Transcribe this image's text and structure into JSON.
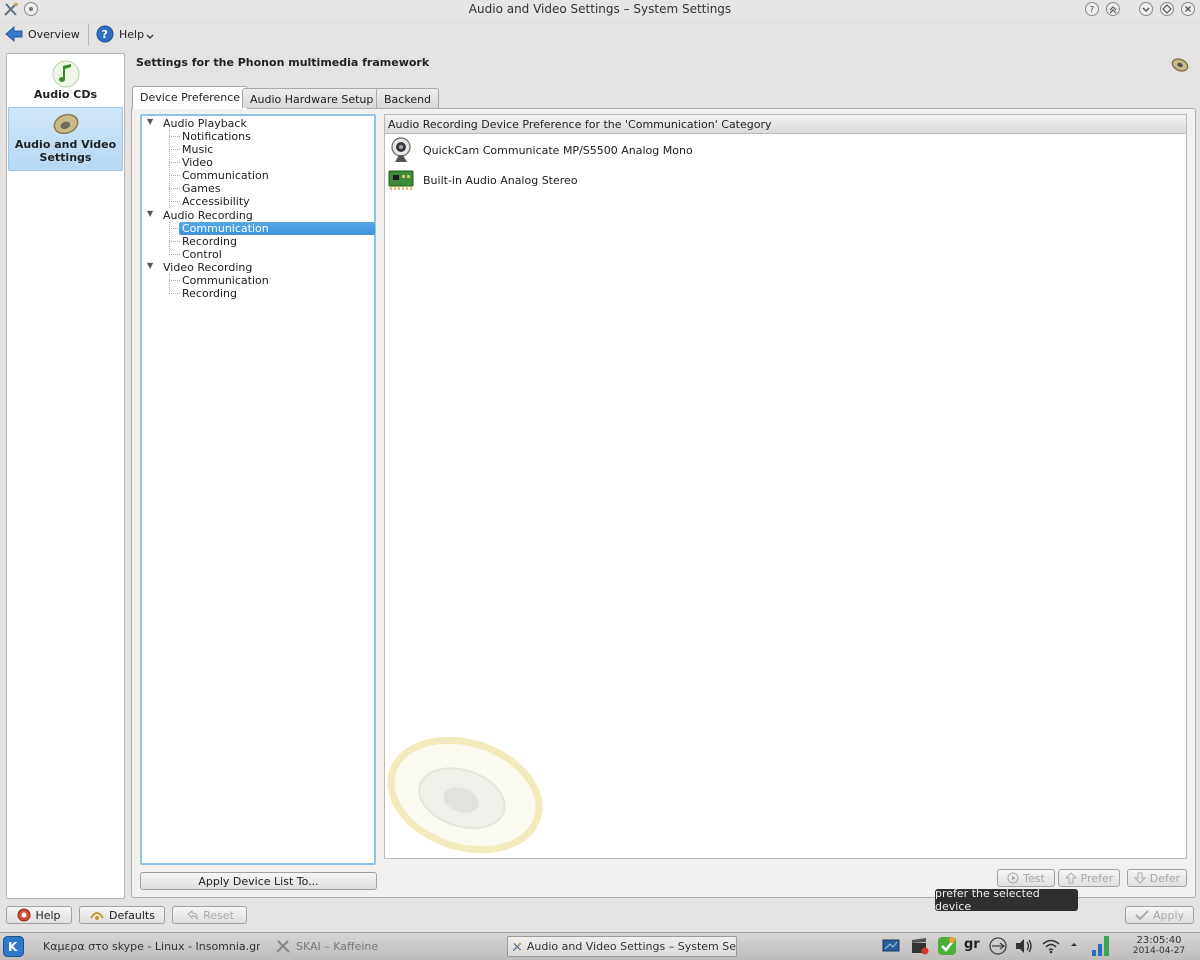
{
  "window": {
    "title": "Audio and Video Settings – System Settings"
  },
  "toolbar": {
    "overview": "Overview",
    "help": "Help"
  },
  "sidebar": {
    "items": [
      {
        "label": "Audio CDs",
        "icon": "music-note-icon"
      },
      {
        "label": "Audio and Video Settings",
        "icon": "speaker-icon",
        "selected": true
      }
    ]
  },
  "page": {
    "heading": "Settings for the Phonon multimedia framework"
  },
  "tabs": [
    {
      "label": "Device Preference",
      "active": true
    },
    {
      "label": "Audio Hardware Setup"
    },
    {
      "label": "Backend"
    }
  ],
  "tree": {
    "audio_playback": {
      "label": "Audio Playback",
      "children": [
        "Notifications",
        "Music",
        "Video",
        "Communication",
        "Games",
        "Accessibility"
      ]
    },
    "audio_recording": {
      "label": "Audio Recording",
      "children": [
        "Communication",
        "Recording",
        "Control"
      ],
      "selected": "Communication"
    },
    "video_recording": {
      "label": "Video Recording",
      "children": [
        "Communication",
        "Recording"
      ]
    }
  },
  "apply_device_list": "Apply Device List To...",
  "device_list": {
    "header": "Audio Recording Device Preference for the 'Communication' Category",
    "devices": [
      "QuickCam Communicate MP/S5500 Analog Mono",
      "Built-in Audio Analog Stereo"
    ]
  },
  "device_buttons": {
    "test": "Test",
    "prefer": "Prefer",
    "defer": "Defer"
  },
  "tooltip": "prefer the selected device",
  "bottom_buttons": {
    "help": "Help",
    "defaults": "Defaults",
    "reset": "Reset",
    "apply": "Apply"
  },
  "taskbar": {
    "tasks": [
      "Καμερα στο skype - Linux - Insomnia.gr",
      "SKAI – Kaffeine",
      "Audio and Video Settings – System Se"
    ],
    "keyboard_layout": "gr",
    "clock_time": "23:05:40",
    "clock_date": "2014-04-27"
  },
  "colors": {
    "selection": "#3f93da",
    "accent_border": "#8ec3ea",
    "tooltip_bg": "#2f2f2f"
  }
}
